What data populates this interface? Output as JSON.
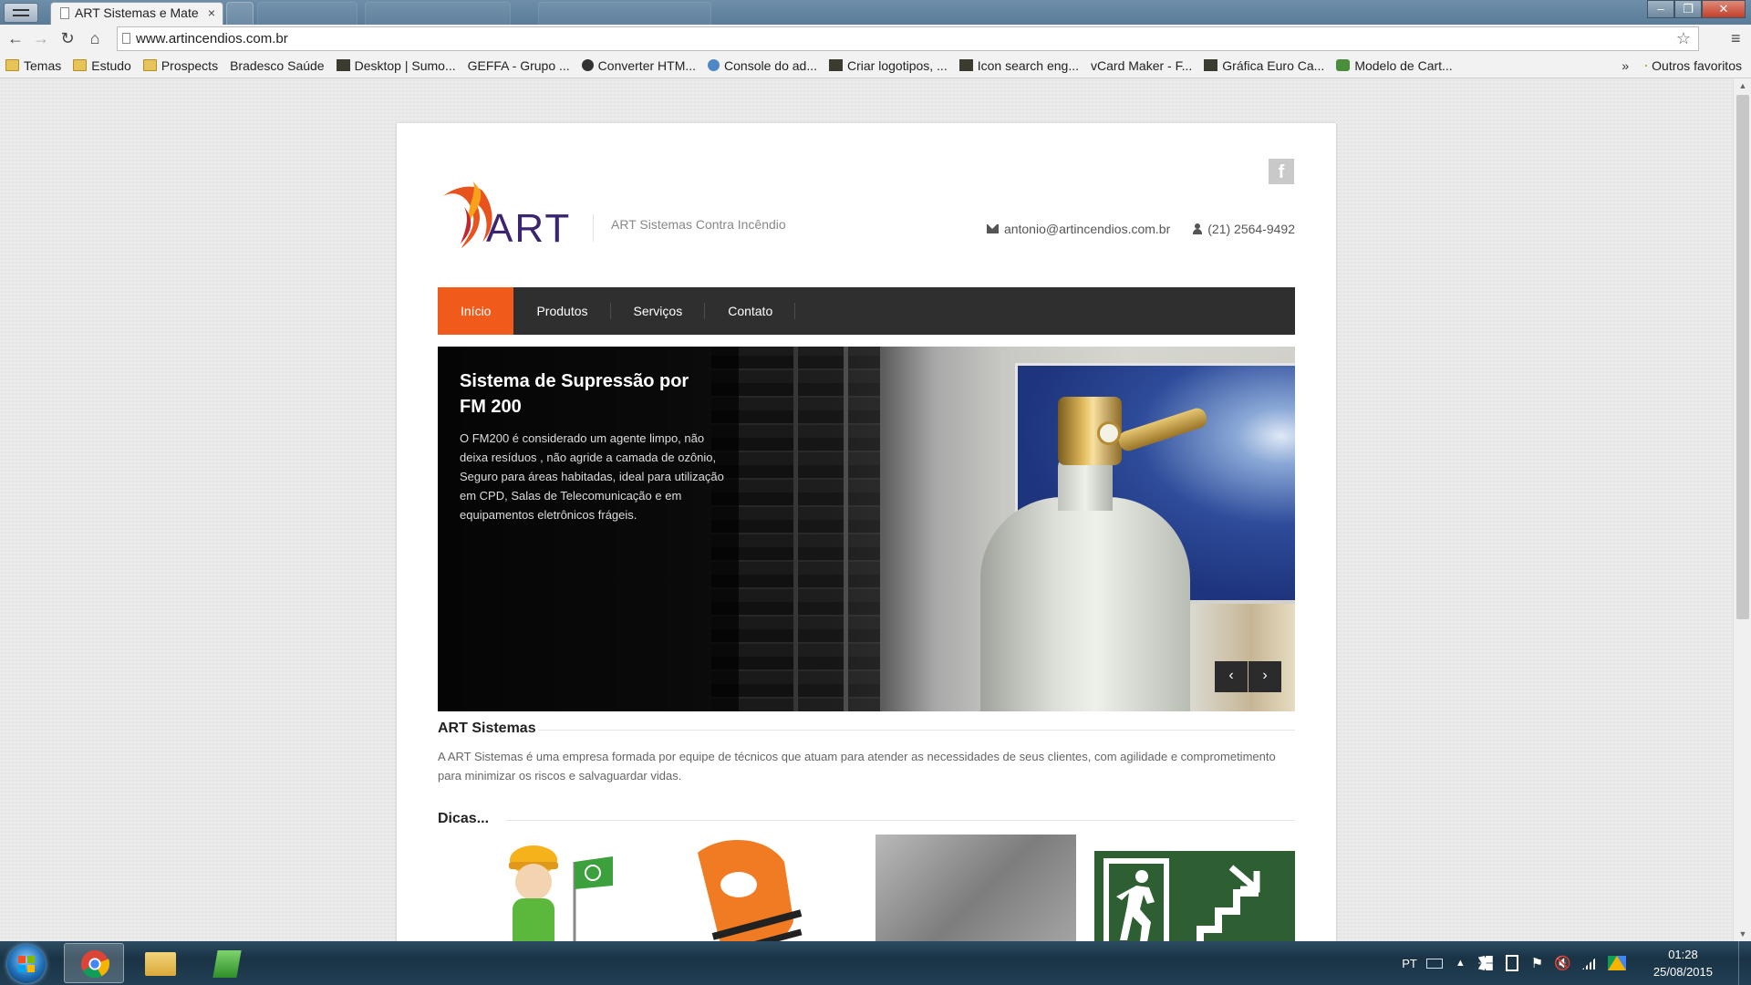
{
  "browser": {
    "tab_title": "ART Sistemas e Mate",
    "tab_close": "×",
    "url": "www.artincendios.com.br",
    "bookmarks": [
      {
        "label": "Temas",
        "icon": "folder-icon"
      },
      {
        "label": "Estudo",
        "icon": "folder-icon"
      },
      {
        "label": "Prospects",
        "icon": "folder-icon"
      },
      {
        "label": "Bradesco Saúde",
        "icon": "page-icon"
      },
      {
        "label": "Desktop | Sumo...",
        "icon": "sumo-icon"
      },
      {
        "label": "GEFFA - Grupo ...",
        "icon": "page-icon"
      },
      {
        "label": "Converter HTM...",
        "icon": "converter-icon"
      },
      {
        "label": "Console do ad...",
        "icon": "console-icon"
      },
      {
        "label": "Criar logotipos, ...",
        "icon": "logo-icon"
      },
      {
        "label": "Icon search eng...",
        "icon": "icon-search-icon"
      },
      {
        "label": "vCard Maker - F...",
        "icon": "vcard-icon"
      },
      {
        "label": "Gráfica Euro Ca...",
        "icon": "grafica-icon"
      },
      {
        "label": "Modelo de Cart...",
        "icon": "modelo-icon"
      }
    ],
    "bookmarks_more": "»",
    "other_bookmarks": "Outros favoritos"
  },
  "site": {
    "tagline": "ART Sistemas Contra Incêndio",
    "logo_text": "ART",
    "email": "antonio@artincendios.com.br",
    "phone": "(21) 2564-9492",
    "facebook": "f",
    "nav": [
      "Início",
      "Produtos",
      "Serviços",
      "Contato"
    ],
    "slide": {
      "title": "Sistema de Supressão por FM 200",
      "text": "O FM200 é considerado um agente limpo, não deixa resíduos , não agride a camada de ozônio, Seguro para áreas habitadas, ideal para utilização em CPD, Salas de Telecomunicação e em equipamentos eletrônicos frágeis.",
      "prev": "‹",
      "next": "›"
    },
    "about": {
      "title": "ART Sistemas",
      "text": "A ART Sistemas é uma empresa formada por equipe de técnicos que atuam para atender as necessidades de seus clientes, com agilidade e comprometimento para minimizar os riscos e salvaguardar vidas."
    },
    "tips_title": "Dicas...",
    "brand_color": "#f05a1a"
  },
  "taskbar": {
    "lang": "PT",
    "time": "01:28",
    "date": "25/08/2015"
  }
}
